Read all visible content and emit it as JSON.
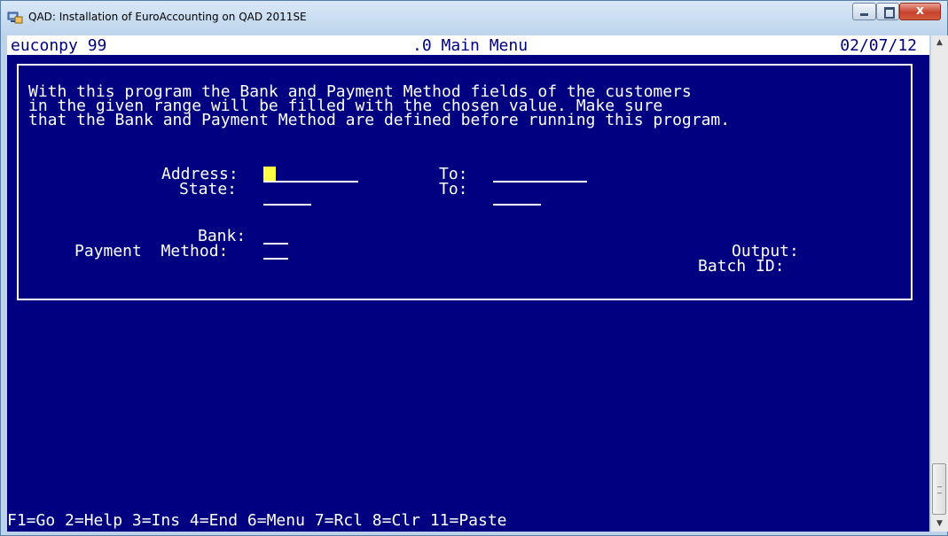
{
  "window": {
    "title": "QAD: Installation of EuroAccounting on QAD 2011SE",
    "close_glyph": "x",
    "icon": "qad-app-icon",
    "colors": {
      "terminal_bg": "#000080",
      "terminal_fg": "#ffffff",
      "cursor": "#ffff44",
      "close_button": "#c7432b"
    }
  },
  "status": {
    "program": "euconpy 99",
    "menu": ".0 Main Menu",
    "date": "02/07/12"
  },
  "description": [
    "With this program the Bank and Payment Method fields of the customers",
    "in the given range will be filled with the chosen value. Make sure",
    "that the Bank and Payment Method are defined before running this program."
  ],
  "form": {
    "address_label": "Address:",
    "address_to_label": "To:",
    "state_label": "State:",
    "state_to_label": "To:",
    "bank_label": "Bank:",
    "payment_method_label": "Payment  Method:",
    "output_label": "Output:",
    "batch_id_label": "Batch ID:",
    "address_value": "",
    "address_to_value": "",
    "state_value": "",
    "state_to_value": "",
    "bank_value": "",
    "payment_method_value": ""
  },
  "function_keys": "F1=Go 2=Help 3=Ins 4=End 6=Menu 7=Rcl 8=Clr 11=Paste",
  "scrollbar": {
    "up_icon": "triangle-up",
    "down_icon": "triangle-down",
    "up_glyph": "▲",
    "down_glyph": "▼"
  }
}
